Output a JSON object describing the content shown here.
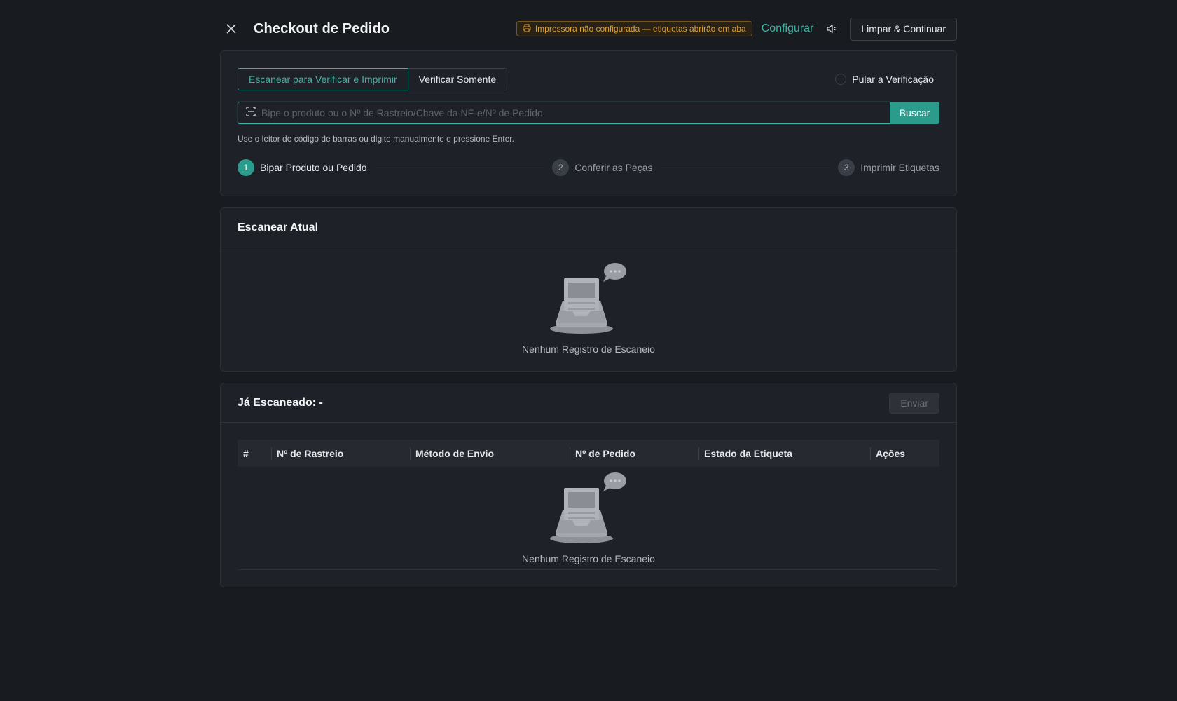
{
  "header": {
    "title": "Checkout de Pedido",
    "printer_warning": "Impressora não configurada — etiquetas abrirão em aba",
    "configure_label": "Configurar",
    "clear_continue_label": "Limpar & Continuar"
  },
  "scan": {
    "modes": [
      "Escanear para Verificar e Imprimir",
      "Verificar Somente"
    ],
    "active_mode": "Escanear para Verificar e Imprimir",
    "skip_label": "Pular a Verificação",
    "skip_checked": false,
    "input_placeholder": "Bipe o produto ou o Nº de Rastreio/Chave da NF-e/Nº de Pedido",
    "input_value": "",
    "search_label": "Buscar",
    "hint": "Use o leitor de código de barras ou digite manualmente e pressione Enter."
  },
  "steps": [
    {
      "num": "1",
      "label": "Bipar Produto ou Pedido",
      "active": true
    },
    {
      "num": "2",
      "label": "Conferir as Peças",
      "active": false
    },
    {
      "num": "3",
      "label": "Imprimir Etiquetas",
      "active": false
    }
  ],
  "current_scan": {
    "title": "Escanear Atual",
    "empty_text": "Nenhum Registro de Escaneio"
  },
  "scanned": {
    "title": "Já Escaneado: -",
    "send_label": "Enviar",
    "columns": [
      "#",
      "Nº de Rastreio",
      "Método de Envio",
      "Nº de Pedido",
      "Estado da Etiqueta",
      "Ações"
    ],
    "rows": [],
    "empty_text": "Nenhum Registro de Escaneio"
  },
  "icons": {
    "close": "close-icon",
    "printer": "printer-icon",
    "sound": "speaker-icon",
    "scan": "barcode-scan-icon",
    "empty": "empty-inbox-icon"
  },
  "colors": {
    "accent": "#2b9c8c",
    "accent_text": "#3bb5a3",
    "warning": "#e0a030",
    "background": "#181b20",
    "card": "#1e2127"
  }
}
